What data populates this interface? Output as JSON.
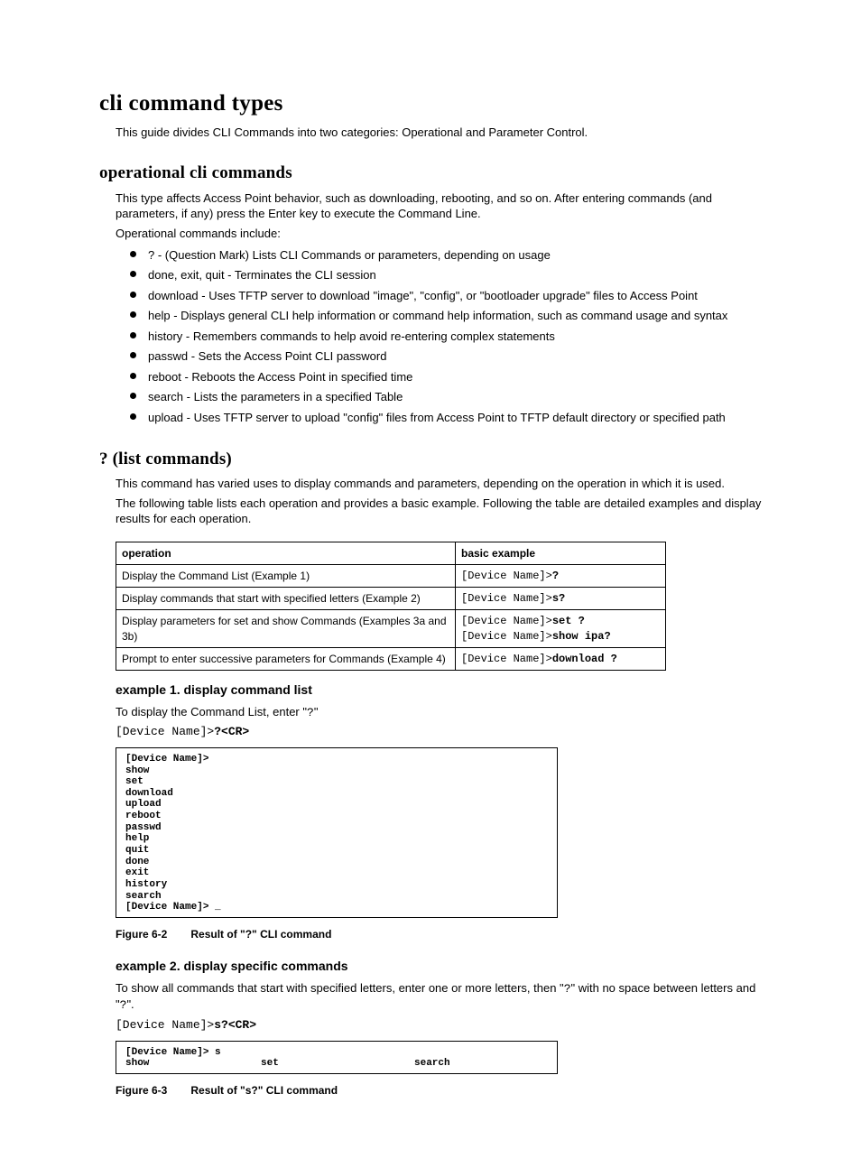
{
  "title": "cli command types",
  "intro": "This guide divides CLI Commands into two categories: Operational and Parameter Control.",
  "section_operational": {
    "heading": "operational cli commands",
    "p1": "This type affects Access Point behavior, such as downloading, rebooting, and so on. After entering commands (and parameters, if any) press the Enter key to execute the Command Line.",
    "p2": "Operational commands include:",
    "items": [
      "? - (Question Mark) Lists CLI Commands or parameters, depending on usage",
      "done, exit, quit - Terminates the CLI session",
      "download - Uses TFTP server to download \"image\", \"config\", or \"bootloader upgrade\" files to Access Point",
      "help - Displays general CLI help information or command help information, such as command usage and syntax",
      "history - Remembers commands to help avoid re-entering complex statements",
      "passwd - Sets the Access Point CLI password",
      "reboot - Reboots the Access Point in specified time",
      "search - Lists the parameters in a specified Table",
      "upload - Uses TFTP server to upload \"config\" files from Access Point to TFTP default directory or specified path"
    ]
  },
  "section_list": {
    "heading": "? (list commands)",
    "p1": "This command has varied uses to display commands and parameters, depending on the operation in which it is used.",
    "p2": "The following table lists each operation and provides a basic example. Following the table are detailed examples and display results for each operation."
  },
  "table": {
    "col_operation": "operation",
    "col_example": "basic example",
    "rows": [
      {
        "operation": "Display the Command List (Example 1)",
        "ex_prefix": "[Device Name]>",
        "ex_cmd": "?"
      },
      {
        "operation": "Display commands that start with specified letters (Example 2)",
        "ex_prefix": "[Device Name]>",
        "ex_cmd": "s?"
      },
      {
        "operation": "Display parameters for set and show Commands (Examples 3a and 3b)",
        "ex_prefix": "[Device Name]>",
        "ex_cmd": "set ?",
        "ex_prefix2": "[Device Name]>",
        "ex_cmd2": "show ipa?"
      },
      {
        "operation": "Prompt to enter successive parameters for Commands (Example 4)",
        "ex_prefix": "[Device Name]>",
        "ex_cmd": "download ?"
      }
    ]
  },
  "example1": {
    "heading": "example 1. display command list",
    "p1_a": "To display the Command List, enter \"",
    "p1_mono": "?",
    "p1_b": "\"",
    "prompt_prefix": "[Device Name]>",
    "prompt_cmd": "?<CR>",
    "terminal": "[Device Name]>\nshow\nset\ndownload\nupload\nreboot\npasswd\nhelp\nquit\ndone\nexit\nhistory\nsearch\n[Device Name]> _",
    "caption_fig": "Figure 6-2",
    "caption_text": "Result of \"?\" CLI command"
  },
  "example2": {
    "heading": "example 2. display specific commands",
    "p1_a": "To show all commands that start with specified letters, enter one or more letters, then \"",
    "p1_mono1": "?",
    "p1_b": "\" with no space between letters and \"",
    "p1_mono2": "?",
    "p1_c": "\".",
    "prompt_prefix": "[Device Name]>",
    "prompt_cmd": "s?<CR>",
    "terminal_line1": "[Device Name]> s",
    "term_col1": "show",
    "term_col2": "set",
    "term_col3": "search",
    "caption_fig": "Figure 6-3",
    "caption_text": "Result of \"s?\" CLI command"
  }
}
